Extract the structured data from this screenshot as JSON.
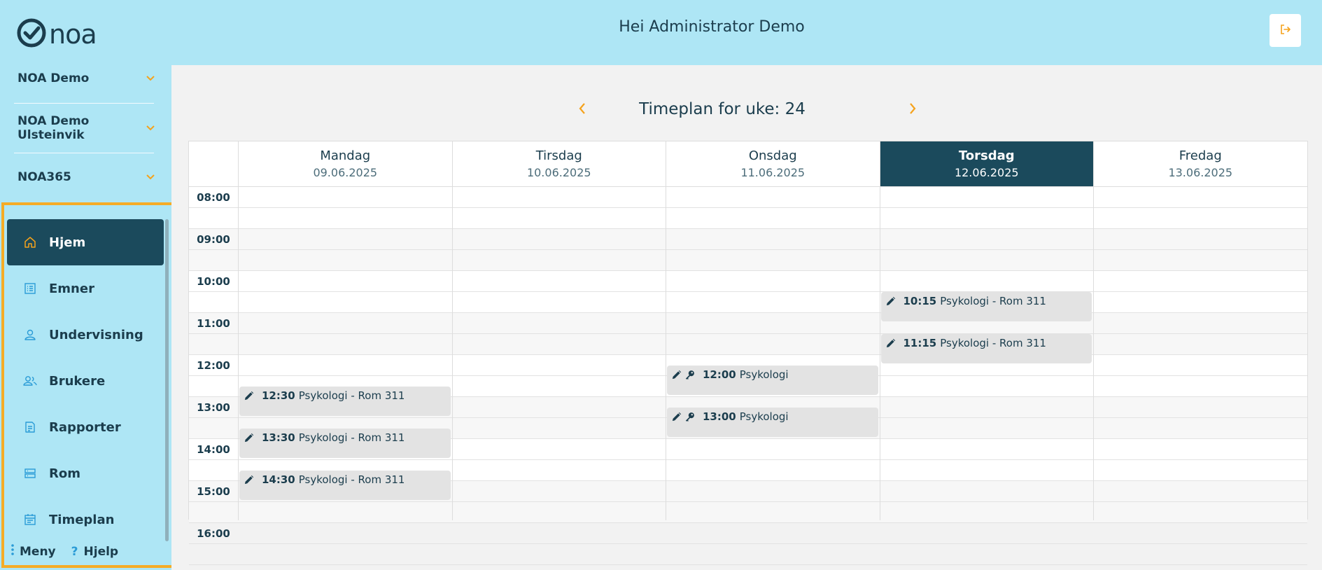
{
  "logo": {
    "text": "noa"
  },
  "header": {
    "greeting": "Hei Administrator Demo"
  },
  "orgs": [
    {
      "label": "NOA Demo"
    },
    {
      "label": "NOA Demo Ulsteinvik"
    },
    {
      "label": "NOA365"
    }
  ],
  "nav": [
    {
      "label": "Hjem",
      "icon": "home-icon",
      "active": true
    },
    {
      "label": "Emner",
      "icon": "list-icon",
      "active": false
    },
    {
      "label": "Undervisning",
      "icon": "person-icon",
      "active": false
    },
    {
      "label": "Brukere",
      "icon": "users-icon",
      "active": false
    },
    {
      "label": "Rapporter",
      "icon": "report-icon",
      "active": false
    },
    {
      "label": "Rom",
      "icon": "room-icon",
      "active": false
    },
    {
      "label": "Timeplan",
      "icon": "calendar-icon",
      "active": false
    }
  ],
  "bottom": {
    "menu_label": "Meny",
    "help_label": "Hjelp"
  },
  "schedule": {
    "title": "Timeplan for uke: 24",
    "days": [
      {
        "name": "Mandag",
        "date": "09.06.2025",
        "today": false
      },
      {
        "name": "Tirsdag",
        "date": "10.06.2025",
        "today": false
      },
      {
        "name": "Onsdag",
        "date": "11.06.2025",
        "today": false
      },
      {
        "name": "Torsdag",
        "date": "12.06.2025",
        "today": true
      },
      {
        "name": "Fredag",
        "date": "13.06.2025",
        "today": false
      }
    ],
    "times": [
      "08:00",
      "09:00",
      "10:00",
      "11:00",
      "12:00",
      "13:00",
      "14:00",
      "15:00",
      "16:00"
    ],
    "events": [
      {
        "day": 0,
        "time": "12:30",
        "title": "Psykologi - Rom 311",
        "key": false
      },
      {
        "day": 0,
        "time": "13:30",
        "title": "Psykologi - Rom 311",
        "key": false
      },
      {
        "day": 0,
        "time": "14:30",
        "title": "Psykologi - Rom 311",
        "key": false
      },
      {
        "day": 2,
        "time": "12:00",
        "title": "Psykologi",
        "key": true
      },
      {
        "day": 2,
        "time": "13:00",
        "title": "Psykologi",
        "key": true
      },
      {
        "day": 3,
        "time": "10:15",
        "title": "Psykologi - Rom 311",
        "key": false
      },
      {
        "day": 3,
        "time": "11:15",
        "title": "Psykologi - Rom 311",
        "key": false
      }
    ]
  },
  "colors": {
    "accent": "#f5a21b",
    "primary": "#1b4a5c",
    "header_bg": "#aee6f5"
  }
}
